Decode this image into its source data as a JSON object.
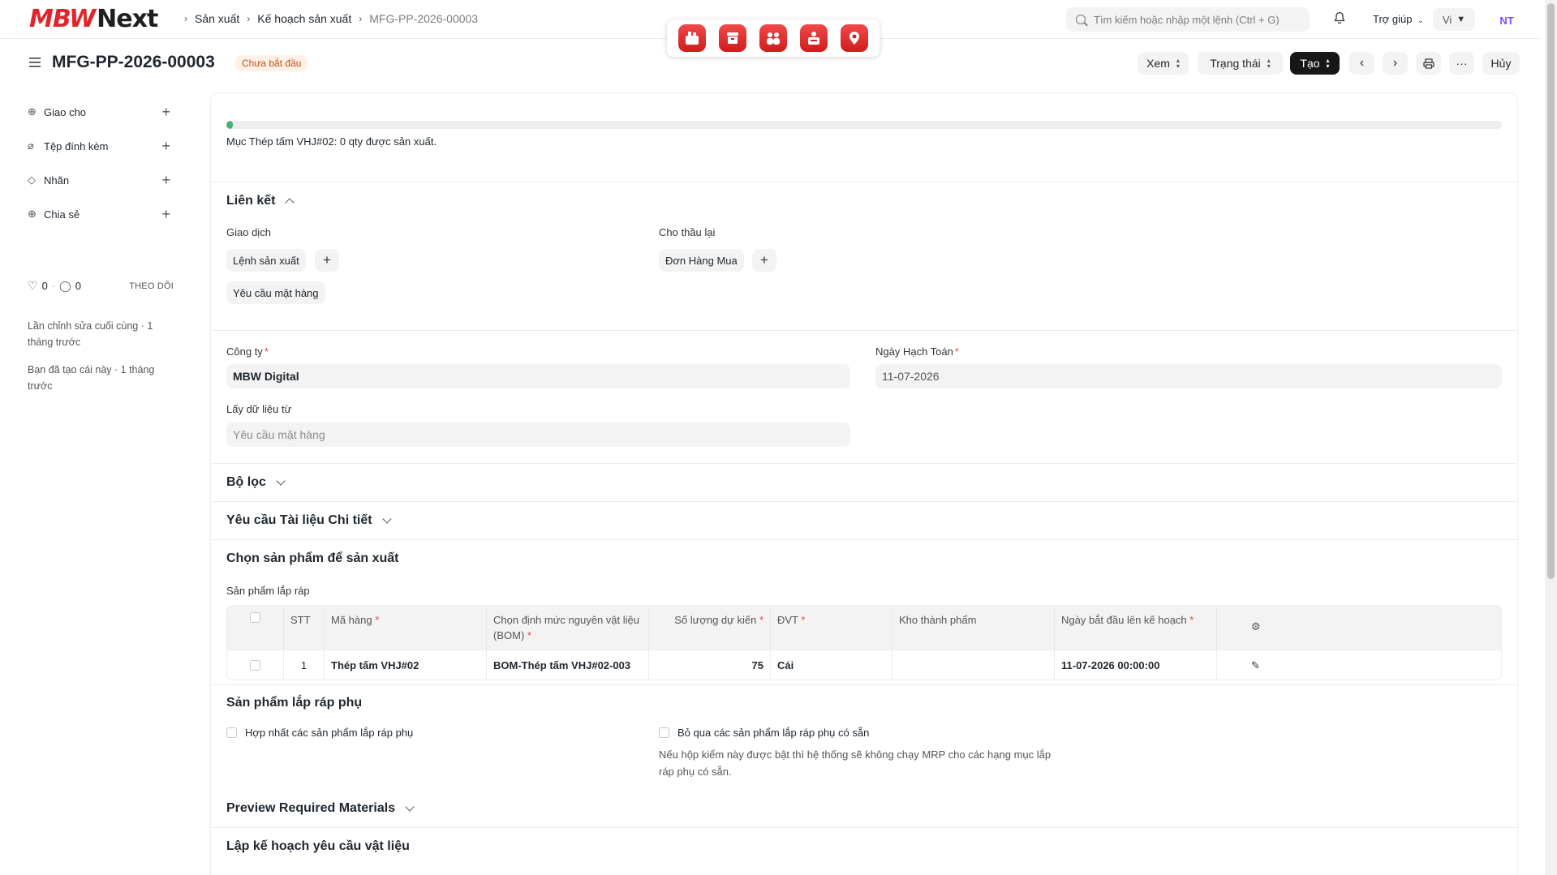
{
  "logo": {
    "part1": "MBW",
    "part2": "Next"
  },
  "breadcrumb": {
    "items": [
      "Sản xuất",
      "Kế hoạch sản xuất",
      "MFG-PP-2026-00003"
    ]
  },
  "app_icons": [
    "factory-icon",
    "box-icon",
    "team-icon",
    "server-icon",
    "location-icon"
  ],
  "search": {
    "placeholder": "Tìm kiếm hoặc nhập một lệnh (Ctrl + G)"
  },
  "navbar": {
    "help_label": "Trợ giúp",
    "lang_label": "Vi",
    "avatar_initials": "NT"
  },
  "page": {
    "title": "MFG-PP-2026-00003",
    "status": "Chưa bắt đầu"
  },
  "toolbar": {
    "view_label": "Xem",
    "status_label": "Trạng thái",
    "create_label": "Tạo",
    "more_label": "···",
    "cancel_label": "Hủy"
  },
  "sidebar": {
    "items": [
      {
        "label": "Giao cho"
      },
      {
        "label": "Tệp đính kèm"
      },
      {
        "label": "Nhãn"
      },
      {
        "label": "Chia sẻ"
      }
    ],
    "likes": "0",
    "comments": "0",
    "follow_label": "THEO DÕI",
    "last_edit": "Lần chỉnh sửa cuối cùng · 1 tháng trước",
    "created": "Bạn đã tạo cái này · 1 tháng trước"
  },
  "progress": {
    "percent": 0.5,
    "note": "Mục Thép tấm VHJ#02: 0 qty được sản xuất."
  },
  "links": {
    "title": "Liên kết",
    "transactions_label": "Giao dịch",
    "subcontract_label": "Cho thầu lại",
    "work_order": "Lệnh sản xuất",
    "material_request": "Yêu cầu mặt hàng",
    "purchase_order": "Đơn Hàng Mua"
  },
  "form": {
    "company_label": "Công ty",
    "company_value": "MBW Digital",
    "posting_date_label": "Ngày Hạch Toán",
    "posting_date_value": "11-07-2026",
    "get_items_label": "Lấy dữ liệu từ",
    "get_items_placeholder": "Yêu cầu mặt hàng"
  },
  "sections": {
    "filters": "Bộ lọc",
    "document_details": "Yêu cầu Tài liệu Chi tiết",
    "select_items": "Chọn sản phẩm để sản xuất",
    "assembly_items_label": "Sản phẩm lắp ráp",
    "sub_assembly": "Sản phẩm lắp ráp phụ",
    "preview_materials": "Preview Required Materials",
    "material_planning": "Lập kế hoạch yêu cầu vật liệu"
  },
  "table": {
    "headers": {
      "stt": "STT",
      "item_code": "Mã hàng",
      "bom": "Chọn định mức nguyên vật liệu (BOM)",
      "planned_qty": "Số lượng dự kiến",
      "uom": "ĐVT",
      "warehouse": "Kho thành phẩm",
      "start_date": "Ngày bắt đầu lên kế hoạch"
    },
    "rows": [
      {
        "stt": "1",
        "item_code": "Thép tấm VHJ#02",
        "bom": "BOM-Thép tấm VHJ#02-003",
        "planned_qty": "75",
        "uom": "Cái",
        "warehouse": "",
        "start_date": "11-07-2026 00:00:00"
      }
    ]
  },
  "sub_assembly": {
    "combine_label": "Hợp nhất các sản phẩm lắp ráp phụ",
    "skip_label": "Bỏ qua các sản phẩm lắp ráp phụ có sẵn",
    "skip_desc": "Nếu hộp kiểm này được bật thì hệ thống sẽ không chạy MRP cho các hạng mục lắp ráp phụ có sẵn."
  },
  "colors": {
    "brand": "#e0262b",
    "progress": "#4caf77",
    "badge_bg": "#fff1e7",
    "badge_text": "#c24d12"
  }
}
